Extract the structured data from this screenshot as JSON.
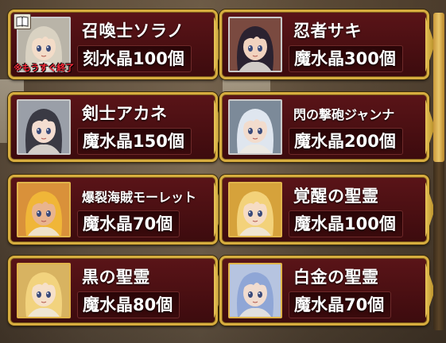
{
  "cards": [
    {
      "name": "召喚士ソラノ",
      "price": "刻水晶100個",
      "note": "※もうすぐ終了",
      "hair": "#d9d2c2",
      "skin": "#f3dcc8",
      "bg": "#b9b4a8",
      "frame": "silver"
    },
    {
      "name": "忍者サキ",
      "price": "魔水晶300個",
      "hair": "#2b2230",
      "skin": "#f1d3bf",
      "bg": "#7a4a40",
      "frame": "silver"
    },
    {
      "name": "剣士アカネ",
      "price": "魔水晶150個",
      "hair": "#3a3a44",
      "skin": "#f4ddd0",
      "bg": "#9a9fa8",
      "frame": "silver"
    },
    {
      "name": "閃の撃砲ジャンナ",
      "price": "魔水晶200個",
      "hair": "#dfe6ef",
      "skin": "#f2dccd",
      "bg": "#7c8a99",
      "frame": "silver"
    },
    {
      "name": "爆裂海賊モーレット",
      "price": "魔水晶70個",
      "hair": "#f0b638",
      "skin": "#e9b48e",
      "bg": "#d9913a",
      "frame": "gold"
    },
    {
      "name": "覚醒の聖霊",
      "price": "魔水晶100個",
      "hair": "#f3d27a",
      "skin": "#f6dcc4",
      "bg": "#d6a23b",
      "frame": "gold"
    },
    {
      "name": "黒の聖霊",
      "price": "魔水晶80個",
      "hair": "#f2d37e",
      "skin": "#f6e0c9",
      "bg": "#d8b361",
      "frame": "gold"
    },
    {
      "name": "白金の聖霊",
      "price": "魔水晶70個",
      "hair": "#8fa6d6",
      "skin": "#f1dccf",
      "bg": "#b6c4e0",
      "frame": "gold"
    }
  ]
}
